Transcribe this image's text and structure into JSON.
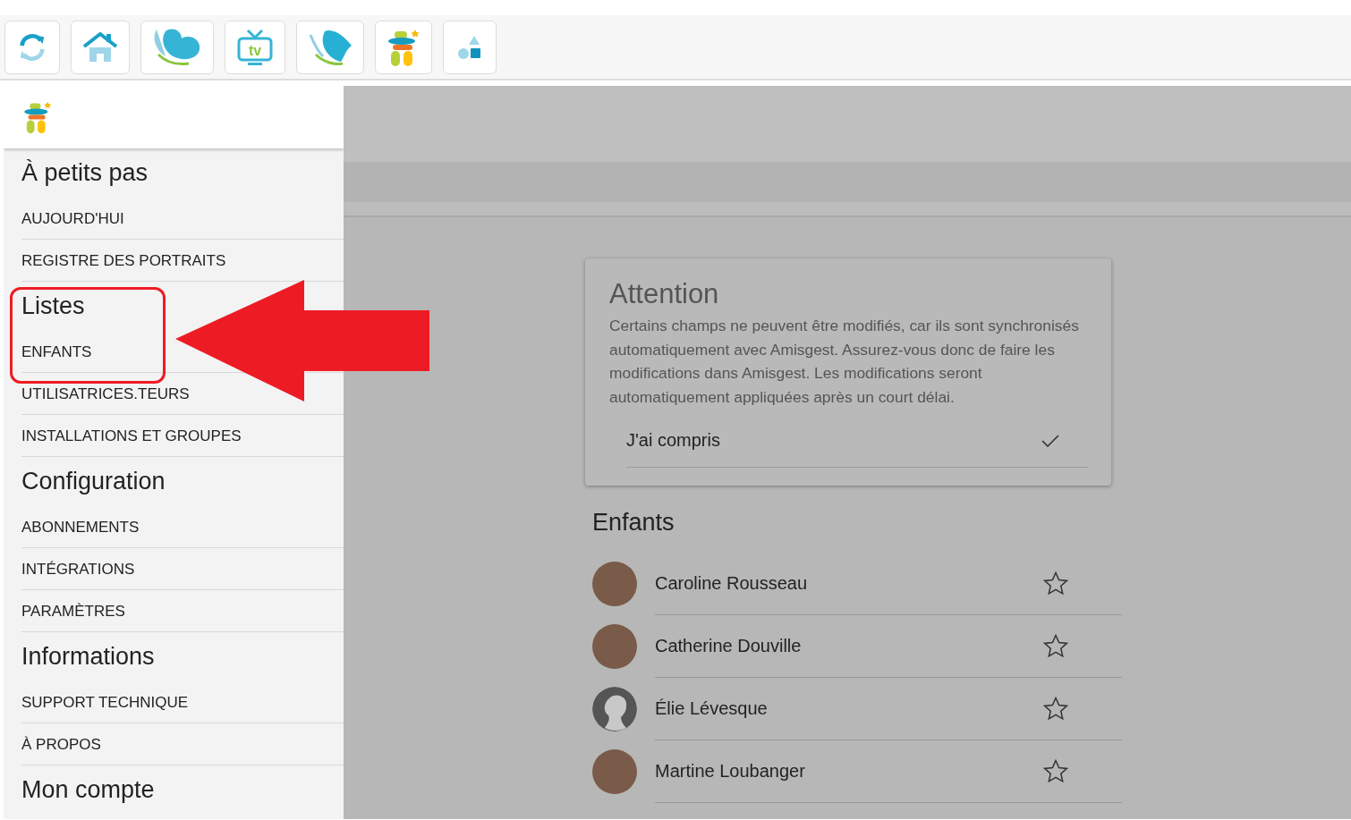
{
  "toolbar": [
    {
      "kind": "refresh"
    },
    {
      "kind": "home"
    },
    {
      "kind": "blob"
    },
    {
      "kind": "tv",
      "label": "tv"
    },
    {
      "kind": "leaf"
    },
    {
      "kind": "figure"
    },
    {
      "kind": "shapes"
    }
  ],
  "sidebar": {
    "sections": [
      {
        "title": "À petits pas",
        "items": [
          "AUJOURD'HUI",
          "REGISTRE DES PORTRAITS"
        ]
      },
      {
        "title": "Listes",
        "items": [
          "ENFANTS",
          "UTILISATRICES.TEURS",
          "INSTALLATIONS ET GROUPES"
        ]
      },
      {
        "title": "Configuration",
        "items": [
          "ABONNEMENTS",
          "INTÉGRATIONS",
          "PARAMÈTRES"
        ]
      },
      {
        "title": "Informations",
        "items": [
          "SUPPORT TECHNIQUE",
          "À PROPOS"
        ]
      },
      {
        "title": "Mon compte"
      }
    ]
  },
  "notice": {
    "title": "Attention",
    "text": "Certains champs ne peuvent être modifiés, car ils sont synchronisés automatiquement avec Amisgest. Assurez-vous donc de faire les modifications dans Amisgest. Les modifications seront automatiquement appliquées après un court délai.",
    "action": "J'ai compris"
  },
  "children_list": {
    "title": "Enfants",
    "items": [
      {
        "name": "Caroline Rousseau",
        "photo": true,
        "favorite": false
      },
      {
        "name": "Catherine Douville",
        "photo": true,
        "favorite": false
      },
      {
        "name": "Élie Lévesque",
        "photo": false,
        "favorite": false
      },
      {
        "name": "Martine Loubanger",
        "photo": true,
        "favorite": false
      }
    ]
  }
}
